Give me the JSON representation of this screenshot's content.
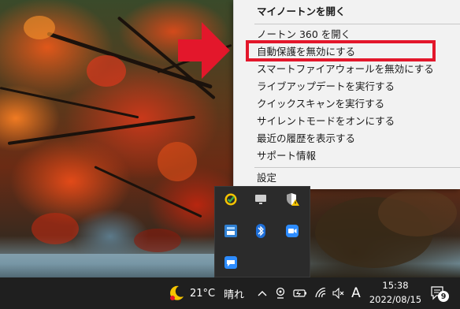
{
  "context_menu": {
    "items": [
      {
        "label": "マイノートンを開く",
        "bold": true
      },
      {
        "label": "ノートン 360 を開く"
      },
      {
        "label": "自動保護を無効にする"
      },
      {
        "label": "スマートファイアウォールを無効にする"
      },
      {
        "label": "ライブアップデートを実行する"
      },
      {
        "label": "クイックスキャンを実行する"
      },
      {
        "label": "サイレントモードをオンにする"
      },
      {
        "label": "最近の履歴を表示する"
      },
      {
        "label": "サポート情報"
      },
      {
        "label": "設定"
      }
    ]
  },
  "colors": {
    "highlight": "#e3172b",
    "arrow": "#e3172b",
    "taskbar": "#1f1f1f",
    "menu_bg": "#f2f2f2"
  },
  "tray_icons": [
    "norton-icon",
    "display-icon",
    "shield-warning-icon",
    "network-app-icon",
    "bluetooth-icon",
    "zoom-icon",
    "chat-icon"
  ],
  "taskbar": {
    "weather_temp": "21°C",
    "weather_text": "晴れ",
    "ime": "A",
    "time": "15:38",
    "date": "2022/08/15",
    "notification_count": "9"
  }
}
